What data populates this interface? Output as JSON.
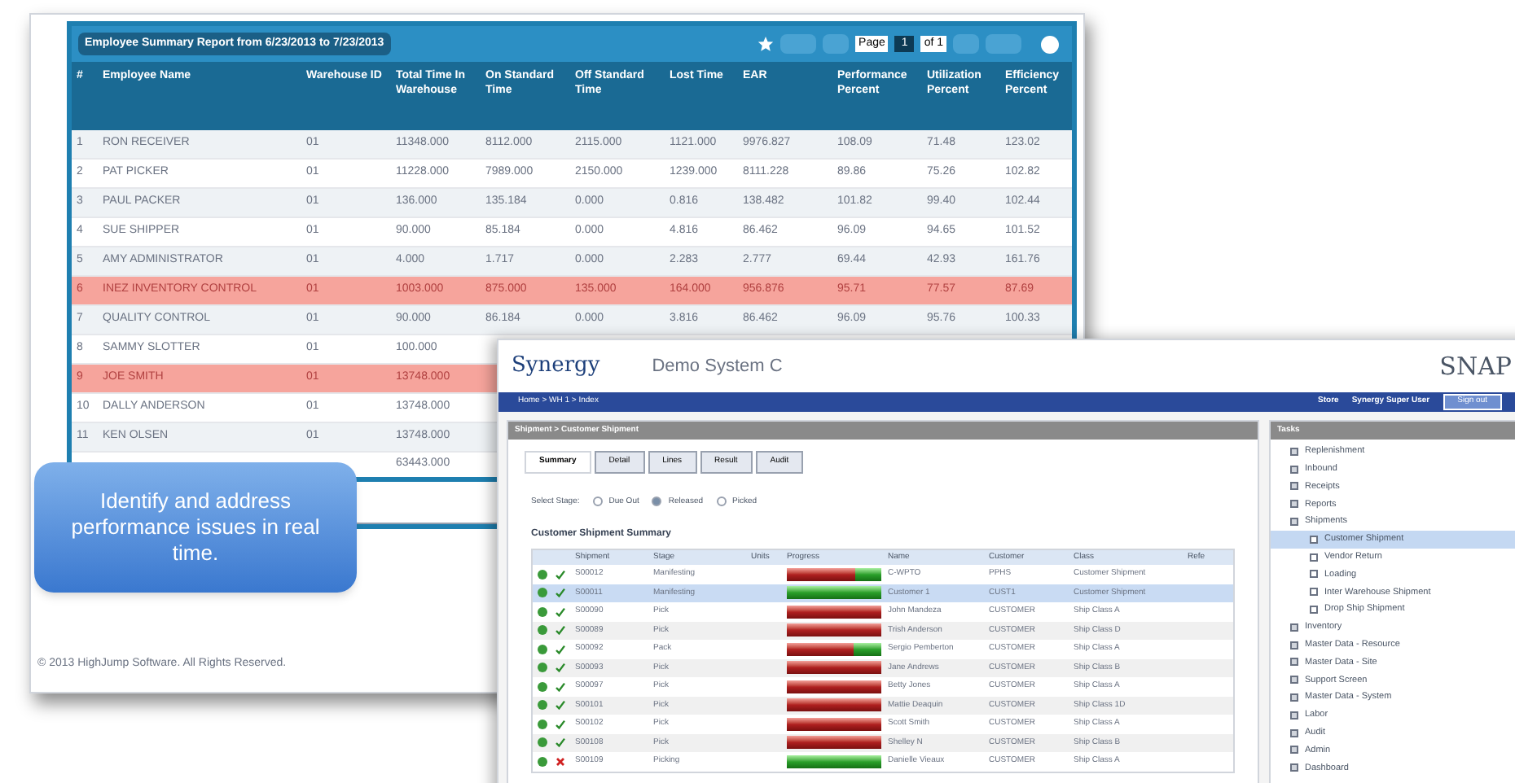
{
  "report": {
    "title": "Employee Summary Report from 6/23/2013 to 7/23/2013",
    "pager": {
      "label": "Page",
      "page": "1",
      "of": "of 1"
    },
    "columns": [
      "#",
      "Employee Name",
      "Warehouse ID",
      "Total Time In Warehouse",
      "On Standard Time",
      "Off Standard Time",
      "Lost Time",
      "EAR",
      "Performance Percent",
      "Utilization Percent",
      "Efficiency Percent"
    ],
    "rows": [
      {
        "flagged": false,
        "cells": [
          "1",
          "RON RECEIVER",
          "01",
          "11348.000",
          "8112.000",
          "2115.000",
          "1121.000",
          "9976.827",
          "108.09",
          "71.48",
          "123.02"
        ]
      },
      {
        "flagged": false,
        "cells": [
          "2",
          "PAT PICKER",
          "01",
          "11228.000",
          "7989.000",
          "2150.000",
          "1239.000",
          "8111.228",
          "89.86",
          "75.26",
          "102.82"
        ]
      },
      {
        "flagged": false,
        "cells": [
          "3",
          "PAUL PACKER",
          "01",
          "136.000",
          "135.184",
          "0.000",
          "0.816",
          "138.482",
          "101.82",
          "99.40",
          "102.44"
        ]
      },
      {
        "flagged": false,
        "cells": [
          "4",
          "SUE SHIPPER",
          "01",
          "90.000",
          "85.184",
          "0.000",
          "4.816",
          "86.462",
          "96.09",
          "94.65",
          "101.52"
        ]
      },
      {
        "flagged": false,
        "cells": [
          "5",
          "AMY ADMINISTRATOR",
          "01",
          "4.000",
          "1.717",
          "0.000",
          "2.283",
          "2.777",
          "69.44",
          "42.93",
          "161.76"
        ]
      },
      {
        "flagged": true,
        "cells": [
          "6",
          "INEZ INVENTORY CONTROL",
          "01",
          "1003.000",
          "875.000",
          "135.000",
          "164.000",
          "956.876",
          "95.71",
          "77.57",
          "87.69"
        ]
      },
      {
        "flagged": false,
        "cells": [
          "7",
          "QUALITY CONTROL",
          "01",
          "90.000",
          "86.184",
          "0.000",
          "3.816",
          "86.462",
          "96.09",
          "95.76",
          "100.33"
        ]
      },
      {
        "flagged": false,
        "cells": [
          "8",
          "SAMMY SLOTTER",
          "01",
          "100.000"
        ]
      },
      {
        "flagged": true,
        "cells": [
          "9",
          "JOE SMITH",
          "01",
          "13748.000"
        ]
      },
      {
        "flagged": false,
        "cells": [
          "10",
          "DALLY ANDERSON",
          "01",
          "13748.000"
        ]
      },
      {
        "flagged": false,
        "cells": [
          "11",
          "KEN OLSEN",
          "01",
          "13748.000"
        ]
      }
    ],
    "total": "63443.000",
    "footer": "© 2013 HighJump Software. All Rights Reserved."
  },
  "callout": "Identify and address performance issues in real time.",
  "app": {
    "logo": "Synergy",
    "system": "Demo System C",
    "brand": "SNAP",
    "breadcrumb": "Home > WH 1 > Index",
    "nav_links": [
      "Store",
      "Synergy Super User"
    ],
    "nav_button": "Sign out",
    "panel_title": "Shipment > Customer Shipment",
    "tabs": [
      {
        "label": "Summary",
        "selected": true
      },
      {
        "label": "Detail",
        "selected": false
      },
      {
        "label": "Lines",
        "selected": false
      },
      {
        "label": "Result",
        "selected": false
      },
      {
        "label": "Audit",
        "selected": false
      }
    ],
    "stage_label": "Select Stage:",
    "stages": [
      {
        "label": "Due Out",
        "selected": false
      },
      {
        "label": "Released",
        "selected": true
      },
      {
        "label": "Picked",
        "selected": false
      }
    ],
    "grid_title": "Customer Shipment Summary",
    "grid_columns": [
      "Shipment",
      "Stage",
      "Units",
      "Progress",
      "Name",
      "Customer",
      "Class",
      "Refe"
    ],
    "grid_rows": [
      {
        "kind": "ok",
        "selected": false,
        "level": 0.28,
        "cells": [
          "S00012",
          "Manifesting",
          "C-WPTO",
          "PPHS",
          "Customer Shipment"
        ]
      },
      {
        "kind": "ok",
        "selected": true,
        "level": 1,
        "cells": [
          "S00011",
          "Manifesting",
          "Customer 1",
          "CUST1",
          "Customer Shipment"
        ]
      },
      {
        "kind": "ok",
        "selected": false,
        "level": 0,
        "cells": [
          "S00090",
          "Pick",
          "John Mandeza",
          "CUSTOMER",
          "Ship Class A"
        ]
      },
      {
        "kind": "ok",
        "selected": false,
        "level": 0,
        "cells": [
          "S00089",
          "Pick",
          "Trish Anderson",
          "CUSTOMER",
          "Ship Class D"
        ]
      },
      {
        "kind": "ok",
        "selected": false,
        "level": 0.3,
        "cells": [
          "S00092",
          "Pack",
          "Sergio Pemberton",
          "CUSTOMER",
          "Ship Class A"
        ]
      },
      {
        "kind": "ok",
        "selected": false,
        "level": 0,
        "cells": [
          "S00093",
          "Pick",
          "Jane Andrews",
          "CUSTOMER",
          "Ship Class B"
        ]
      },
      {
        "kind": "ok",
        "selected": false,
        "level": 0,
        "cells": [
          "S00097",
          "Pick",
          "Betty Jones",
          "CUSTOMER",
          "Ship Class A"
        ]
      },
      {
        "kind": "ok",
        "selected": false,
        "level": 0,
        "cells": [
          "S00101",
          "Pick",
          "Mattie Deaquin",
          "CUSTOMER",
          "Ship Class 1D"
        ]
      },
      {
        "kind": "ok",
        "selected": false,
        "level": 0,
        "cells": [
          "S00102",
          "Pick",
          "Scott Smith",
          "CUSTOMER",
          "Ship Class A"
        ]
      },
      {
        "kind": "ok",
        "selected": false,
        "level": 0,
        "cells": [
          "S00108",
          "Pick",
          "Shelley N",
          "CUSTOMER",
          "Ship Class B"
        ]
      },
      {
        "kind": "error",
        "selected": false,
        "level": 1,
        "cells": [
          "S00109",
          "Picking",
          "Danielle Vieaux",
          "CUSTOMER",
          "Ship Class A"
        ]
      }
    ],
    "tasks_title": "Tasks",
    "tree": [
      {
        "label": "Replenishment",
        "selected": false
      },
      {
        "label": "Inbound",
        "selected": false
      },
      {
        "label": "Receipts",
        "selected": false
      },
      {
        "label": "Reports",
        "selected": false
      },
      {
        "label": "Shipments",
        "selected": false,
        "children": [
          {
            "label": "Customer Shipment",
            "selected": true
          },
          {
            "label": "Vendor Return",
            "selected": false
          },
          {
            "label": "Loading",
            "selected": false
          },
          {
            "label": "Inter Warehouse Shipment",
            "selected": false
          },
          {
            "label": "Drop Ship Shipment",
            "selected": false
          }
        ]
      },
      {
        "label": "Inventory",
        "selected": false
      },
      {
        "label": "Master Data - Resource",
        "selected": false
      },
      {
        "label": "Master Data - Site",
        "selected": false
      },
      {
        "label": "Support Screen",
        "selected": false
      },
      {
        "label": "Master Data - System",
        "selected": false
      },
      {
        "label": "Labor",
        "selected": false
      },
      {
        "label": "Audit",
        "selected": false
      },
      {
        "label": "Admin",
        "selected": false
      },
      {
        "label": "Dashboard",
        "selected": false
      }
    ]
  }
}
